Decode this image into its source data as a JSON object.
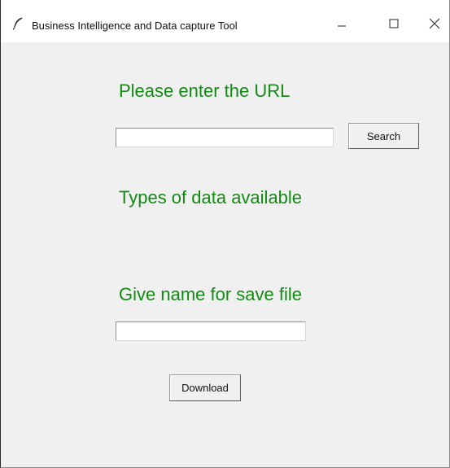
{
  "window": {
    "title": "Business Intelligence and Data capture Tool",
    "app_icon": "feather-icon",
    "controls": {
      "minimize_icon": "minimize-icon",
      "maximize_icon": "maximize-icon",
      "close_icon": "close-icon"
    }
  },
  "url_section": {
    "heading": "Please enter the URL",
    "input_value": "",
    "search_label": "Search"
  },
  "types_section": {
    "heading": "Types of data available"
  },
  "save_section": {
    "heading": "Give name for save file",
    "input_value": "",
    "download_label": "Download"
  },
  "colors": {
    "heading_text": "#138a13",
    "window_background": "#f0f0f0",
    "titlebar_background": "#ffffff"
  }
}
